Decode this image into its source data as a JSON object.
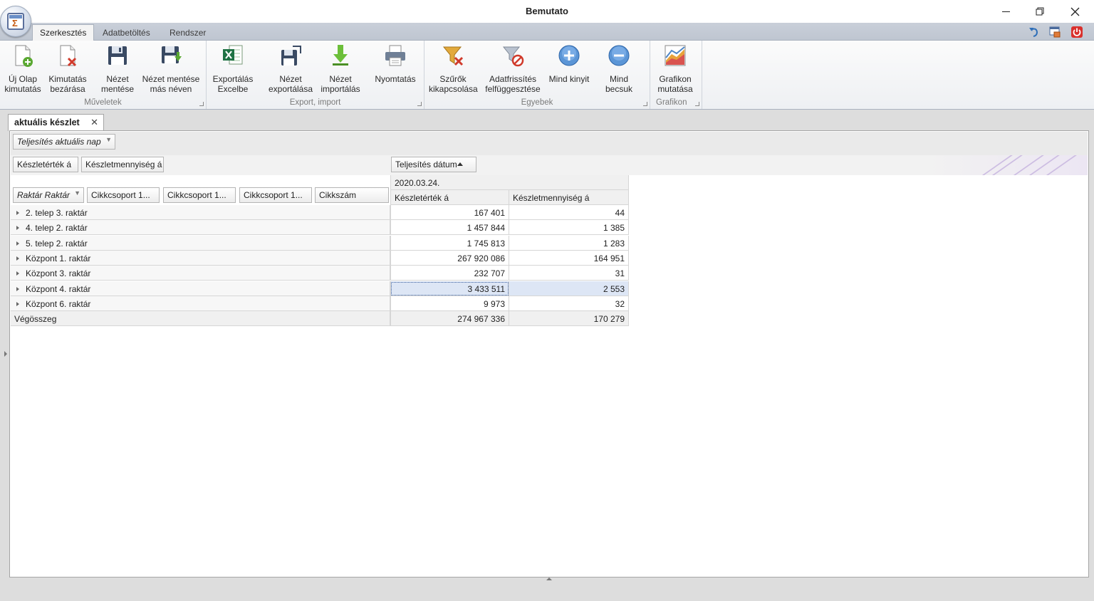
{
  "window": {
    "title": "Bemutato",
    "minimize_icon": "minimize-icon",
    "restore_icon": "restore-icon",
    "close_icon": "close-icon"
  },
  "ribbon_tabs": [
    {
      "label": "Szerkesztés",
      "active": true
    },
    {
      "label": "Adatbetöltés",
      "active": false
    },
    {
      "label": "Rendszer",
      "active": false
    }
  ],
  "quick_access": [
    "undo-icon",
    "window-layout-icon",
    "power-icon"
  ],
  "ribbon_groups": {
    "muveletek": {
      "label": "Műveletek",
      "buttons": [
        {
          "line1": "Új Olap",
          "line2": "kimutatás",
          "icon": "new-pivot-icon"
        },
        {
          "line1": "Kimutatás",
          "line2": "bezárása",
          "icon": "close-pivot-icon"
        },
        {
          "line1": "Nézet",
          "line2": "mentése",
          "icon": "save-view-icon"
        },
        {
          "line1": "Nézet mentése",
          "line2": "más néven",
          "icon": "save-view-as-icon"
        }
      ]
    },
    "export": {
      "label": "Export, import",
      "buttons": [
        {
          "line1": "Exportálás",
          "line2": "Excelbe",
          "icon": "excel-export-icon"
        },
        {
          "line1": "Nézet",
          "line2": "exportálása",
          "icon": "export-view-icon"
        },
        {
          "line1": "Nézet",
          "line2": "importálás",
          "icon": "import-view-icon"
        },
        {
          "line1": "Nyomtatás",
          "line2": "",
          "icon": "printer-icon"
        }
      ]
    },
    "egyebek": {
      "label": "Egyebek",
      "buttons": [
        {
          "line1": "Szűrők",
          "line2": "kikapcsolása",
          "icon": "filter-off-icon"
        },
        {
          "line1": "Adatfrissítés",
          "line2": "felfüggesztése",
          "icon": "suspend-refresh-icon"
        },
        {
          "line1": "Mind kinyit",
          "line2": "",
          "icon": "expand-all-icon"
        },
        {
          "line1": "Mind becsuk",
          "line2": "",
          "icon": "collapse-all-icon"
        }
      ]
    },
    "grafikon": {
      "label": "Grafikon",
      "buttons": [
        {
          "line1": "Grafikon",
          "line2": "mutatása",
          "icon": "chart-icon"
        }
      ]
    }
  },
  "document_tab": {
    "label": "aktuális készlet",
    "close_glyph": "✕"
  },
  "pivot": {
    "filter_field": "Teljesítés aktuális nap",
    "data_fields": [
      "Készletérték á",
      "Készletmennyiség á"
    ],
    "column_field": "Teljesítés dátum",
    "row_fields": [
      "Raktár Raktár",
      "Cikkcsoport 1...",
      "Cikkcsoport 1...",
      "Cikkcsoport 1...",
      "Cikkszám"
    ],
    "column_value": "2020.03.24.",
    "measure_headers": [
      "Készletérték á",
      "Készletmennyiség á"
    ],
    "rows": [
      {
        "label": "2. telep 3. raktár",
        "value": "167 401",
        "qty": "44"
      },
      {
        "label": "4. telep 2. raktár",
        "value": "1 457 844",
        "qty": "1 385"
      },
      {
        "label": "5. telep 2. raktár",
        "value": "1 745 813",
        "qty": "1 283"
      },
      {
        "label": "Központ 1. raktár",
        "value": "267 920 086",
        "qty": "164 951"
      },
      {
        "label": "Központ 3. raktár",
        "value": "232 707",
        "qty": "31"
      },
      {
        "label": "Központ 4. raktár",
        "value": "3 433 511",
        "qty": "2 553"
      },
      {
        "label": "Központ 6. raktár",
        "value": "9 973",
        "qty": "32"
      }
    ],
    "grand_total": {
      "label": "Végösszeg",
      "value": "274 967 336",
      "qty": "170 279"
    },
    "selected_row": 5
  }
}
